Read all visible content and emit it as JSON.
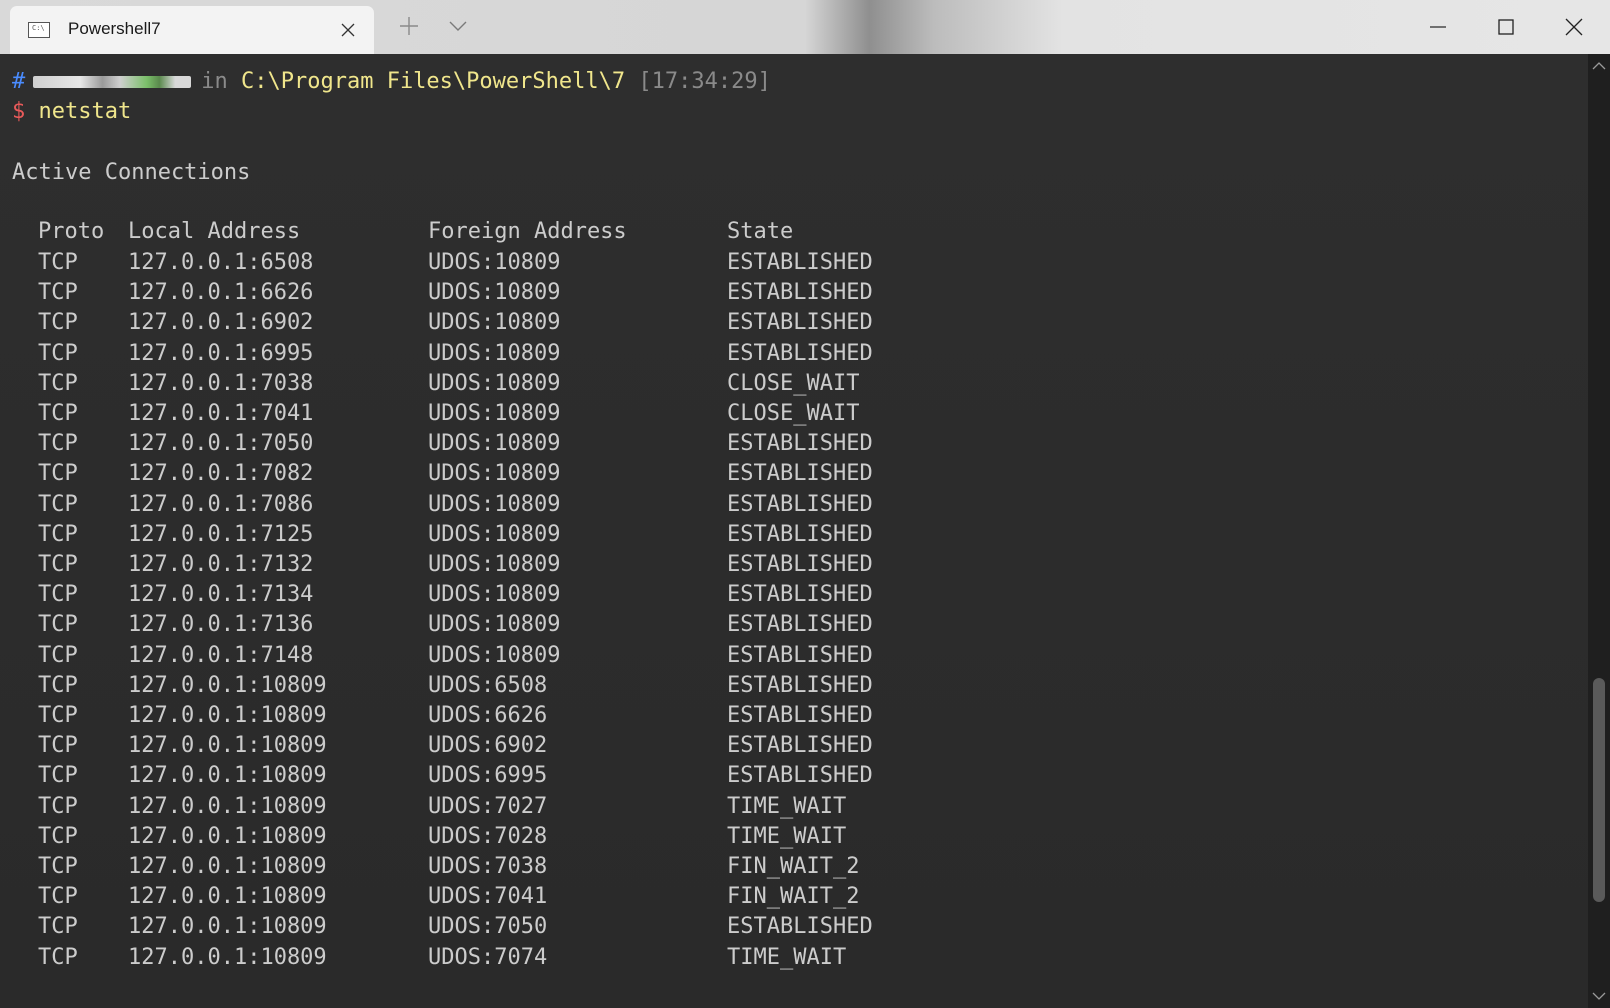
{
  "window": {
    "tab_title": "Powershell7",
    "tab_icon_text": "C:\\"
  },
  "prompt": {
    "hash": "#",
    "in_label": "in",
    "path": "C:\\Program Files\\PowerShell\\7",
    "time": "[17:34:29]",
    "symbol": "$",
    "command": "netstat"
  },
  "output": {
    "heading": "Active Connections",
    "columns": {
      "proto": "Proto",
      "local": "Local Address",
      "foreign": "Foreign Address",
      "state": "State"
    },
    "rows": [
      {
        "proto": "TCP",
        "local": "127.0.0.1:6508",
        "foreign": "UDOS:10809",
        "state": "ESTABLISHED"
      },
      {
        "proto": "TCP",
        "local": "127.0.0.1:6626",
        "foreign": "UDOS:10809",
        "state": "ESTABLISHED"
      },
      {
        "proto": "TCP",
        "local": "127.0.0.1:6902",
        "foreign": "UDOS:10809",
        "state": "ESTABLISHED"
      },
      {
        "proto": "TCP",
        "local": "127.0.0.1:6995",
        "foreign": "UDOS:10809",
        "state": "ESTABLISHED"
      },
      {
        "proto": "TCP",
        "local": "127.0.0.1:7038",
        "foreign": "UDOS:10809",
        "state": "CLOSE_WAIT"
      },
      {
        "proto": "TCP",
        "local": "127.0.0.1:7041",
        "foreign": "UDOS:10809",
        "state": "CLOSE_WAIT"
      },
      {
        "proto": "TCP",
        "local": "127.0.0.1:7050",
        "foreign": "UDOS:10809",
        "state": "ESTABLISHED"
      },
      {
        "proto": "TCP",
        "local": "127.0.0.1:7082",
        "foreign": "UDOS:10809",
        "state": "ESTABLISHED"
      },
      {
        "proto": "TCP",
        "local": "127.0.0.1:7086",
        "foreign": "UDOS:10809",
        "state": "ESTABLISHED"
      },
      {
        "proto": "TCP",
        "local": "127.0.0.1:7125",
        "foreign": "UDOS:10809",
        "state": "ESTABLISHED"
      },
      {
        "proto": "TCP",
        "local": "127.0.0.1:7132",
        "foreign": "UDOS:10809",
        "state": "ESTABLISHED"
      },
      {
        "proto": "TCP",
        "local": "127.0.0.1:7134",
        "foreign": "UDOS:10809",
        "state": "ESTABLISHED"
      },
      {
        "proto": "TCP",
        "local": "127.0.0.1:7136",
        "foreign": "UDOS:10809",
        "state": "ESTABLISHED"
      },
      {
        "proto": "TCP",
        "local": "127.0.0.1:7148",
        "foreign": "UDOS:10809",
        "state": "ESTABLISHED"
      },
      {
        "proto": "TCP",
        "local": "127.0.0.1:10809",
        "foreign": "UDOS:6508",
        "state": "ESTABLISHED"
      },
      {
        "proto": "TCP",
        "local": "127.0.0.1:10809",
        "foreign": "UDOS:6626",
        "state": "ESTABLISHED"
      },
      {
        "proto": "TCP",
        "local": "127.0.0.1:10809",
        "foreign": "UDOS:6902",
        "state": "ESTABLISHED"
      },
      {
        "proto": "TCP",
        "local": "127.0.0.1:10809",
        "foreign": "UDOS:6995",
        "state": "ESTABLISHED"
      },
      {
        "proto": "TCP",
        "local": "127.0.0.1:10809",
        "foreign": "UDOS:7027",
        "state": "TIME_WAIT"
      },
      {
        "proto": "TCP",
        "local": "127.0.0.1:10809",
        "foreign": "UDOS:7028",
        "state": "TIME_WAIT"
      },
      {
        "proto": "TCP",
        "local": "127.0.0.1:10809",
        "foreign": "UDOS:7038",
        "state": "FIN_WAIT_2"
      },
      {
        "proto": "TCP",
        "local": "127.0.0.1:10809",
        "foreign": "UDOS:7041",
        "state": "FIN_WAIT_2"
      },
      {
        "proto": "TCP",
        "local": "127.0.0.1:10809",
        "foreign": "UDOS:7050",
        "state": "ESTABLISHED"
      },
      {
        "proto": "TCP",
        "local": "127.0.0.1:10809",
        "foreign": "UDOS:7074",
        "state": "TIME_WAIT"
      }
    ]
  },
  "icons": {
    "tab": "terminal-icon",
    "tab_close": "close-icon",
    "new_tab": "plus-icon",
    "dropdown": "chevron-down-icon",
    "minimize": "minimize-icon",
    "maximize": "maximize-icon",
    "close": "close-icon",
    "scroll_up": "scroll-up-arrow-icon",
    "scroll_down": "scroll-down-arrow-icon"
  },
  "colors": {
    "terminal_bg": "#2c2c2c",
    "prompt_path": "#f0e68c",
    "prompt_hash": "#4a8cff",
    "prompt_dollar": "#e85a5a",
    "text": "#cccccc"
  }
}
